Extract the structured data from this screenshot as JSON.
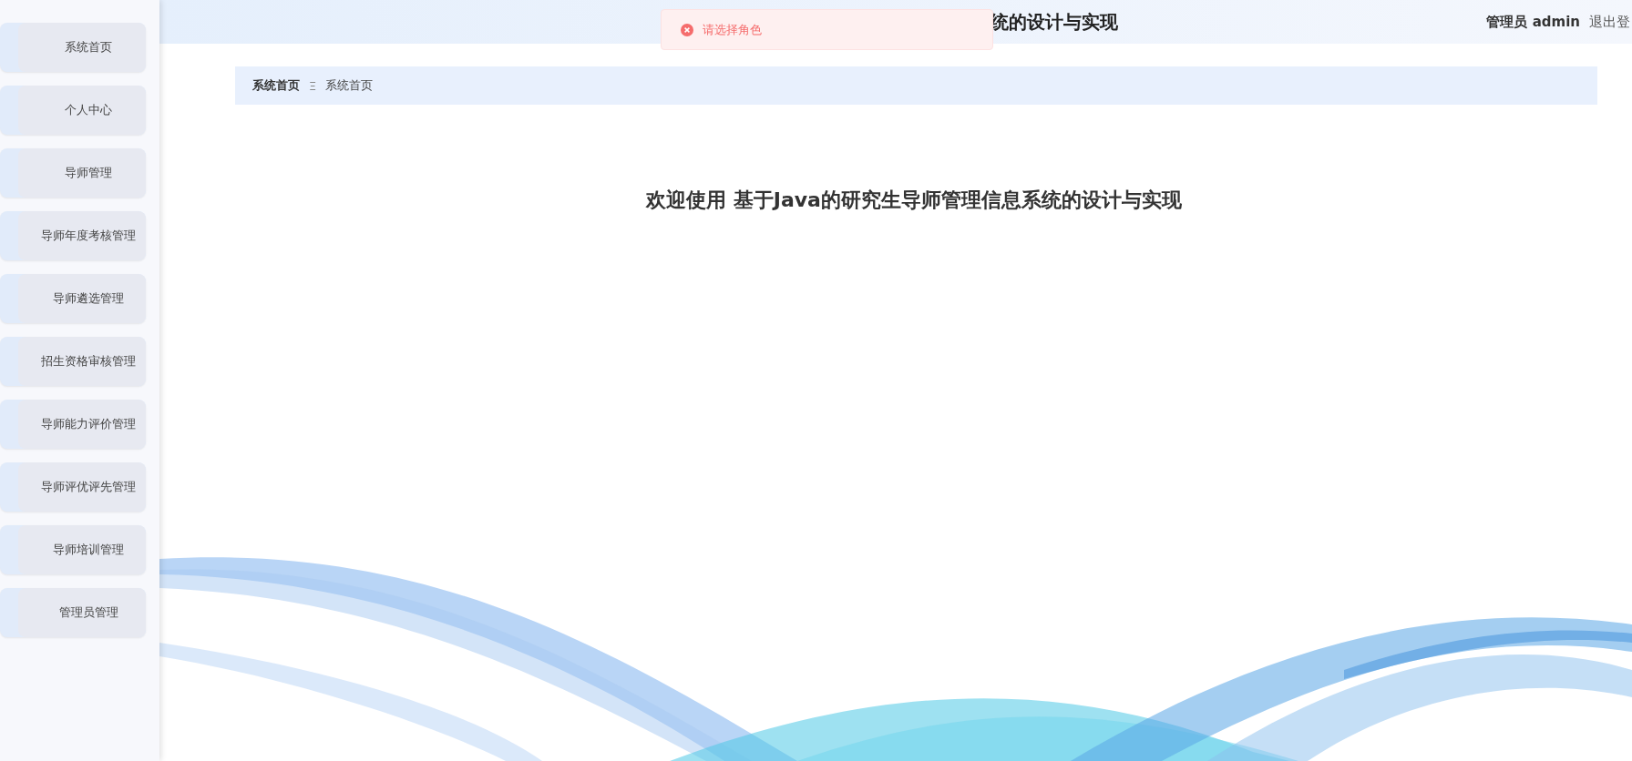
{
  "sidebar": {
    "items": [
      {
        "label": "系统首页"
      },
      {
        "label": "个人中心"
      },
      {
        "label": "导师管理"
      },
      {
        "label": "导师年度考核管理"
      },
      {
        "label": "导师遴选管理"
      },
      {
        "label": "招生资格审核管理"
      },
      {
        "label": "导师能力评价管理"
      },
      {
        "label": "导师评优评先管理"
      },
      {
        "label": "导师培训管理"
      },
      {
        "label": "管理员管理"
      }
    ]
  },
  "header": {
    "title": "统的设计与实现",
    "user_role": "管理员",
    "user_name": "admin",
    "logout": "退出登"
  },
  "toast": {
    "kind": "error",
    "message": "请选择角色"
  },
  "breadcrumb": {
    "items": [
      "系统首页",
      "系统首页"
    ],
    "separator": "Ξ"
  },
  "welcome": "欢迎使用 基于Java的研究生导师管理信息系统的设计与实现"
}
